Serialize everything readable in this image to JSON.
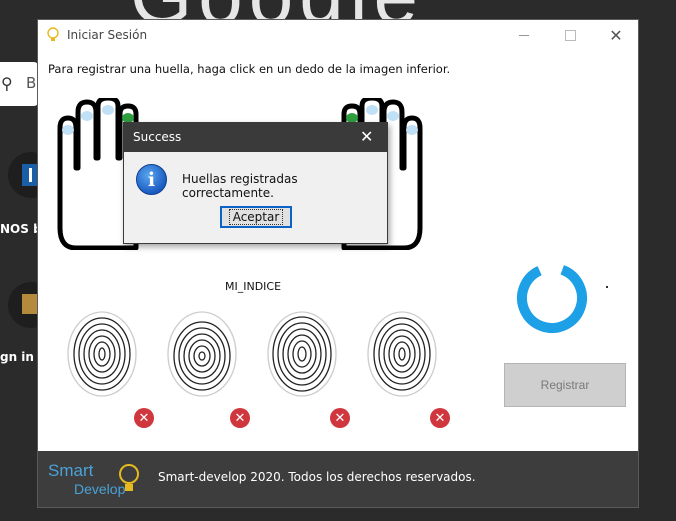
{
  "background": {
    "google_partial": "Google",
    "search_letter": "B",
    "item1_text": "NOS by",
    "item2_text": "gn in [J"
  },
  "window": {
    "title": "Iniciar Sesión",
    "instruction": "Para registrar una huella, haga click en un dedo de la imagen inferior.",
    "finger_label": "MI_INDICE",
    "register_button": "Registrar",
    "spinner_dot": "."
  },
  "fingerprints": [
    {
      "status": "error",
      "mark": "✕"
    },
    {
      "status": "error",
      "mark": "✕"
    },
    {
      "status": "error",
      "mark": "✕"
    },
    {
      "status": "error",
      "mark": "✕"
    }
  ],
  "footer": {
    "logo_line1": "Smart",
    "logo_line2": "Develop",
    "copyright": "Smart-develop 2020. Todos los derechos reservados."
  },
  "dialog": {
    "title": "Success",
    "message": "Huellas registradas correctamente.",
    "ok_button": "Aceptar",
    "icon": "info-icon"
  },
  "colors": {
    "accent_blue": "#1ea0e6",
    "error_red": "#d0363d",
    "finger_green": "#2e9e3e",
    "footer_bg": "#3d3d3d"
  }
}
